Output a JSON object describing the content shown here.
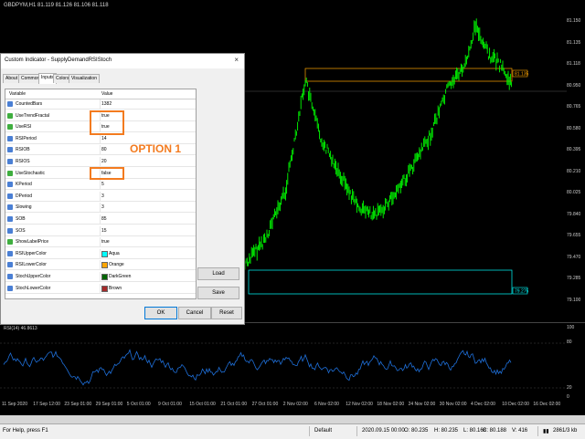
{
  "chart": {
    "header": "GBDPYM,H1 81.119 81.126 81.106 81.118",
    "price_labels": [
      "81.150",
      "81.135",
      "81.118",
      "80.950",
      "80.765",
      "80.580",
      "80.395",
      "80.210",
      "80.025",
      "79.840",
      "79.655",
      "79.470",
      "79.285",
      "79.100"
    ],
    "level_upper": "81.135",
    "level_lower": "79.275",
    "current": "81.118"
  },
  "rsi": {
    "header": "RSI(14) 46.8613",
    "levels": [
      "100",
      "80",
      "20",
      "0"
    ]
  },
  "time_axis": [
    "11 Sep 2020",
    "17 Sep 12:00",
    "23 Sep 01:00",
    "29 Sep 01:00",
    "5 Oct 01:00",
    "9 Oct 01:00",
    "15 Oct 01:00",
    "21 Oct 01:00",
    "27 Oct 01:00",
    "2 Nov 02:00",
    "6 Nov 02:00",
    "12 Nov 02:00",
    "18 Nov 02:00",
    "24 Nov 02:00",
    "30 Nov 02:00",
    "4 Dec 02:00",
    "10 Dec 02:00",
    "16 Dec 02:00"
  ],
  "status": {
    "help": "For Help, press F1",
    "profile": "Default",
    "datetime": "2020.09.15 00:00",
    "open": "O: 80.235",
    "high": "H: 80.235",
    "low": "L: 80.168",
    "close": "C: 80.188",
    "volume": "V: 416",
    "traffic": "2861/3 kb"
  },
  "dialog": {
    "title": "Custom Indicator - SupplyDemandRSIStoch",
    "close": "×",
    "tabs": [
      "About",
      "Common",
      "Inputs",
      "Colors",
      "Visualization"
    ],
    "active_tab": 2,
    "columns": [
      "Variable",
      "Value"
    ],
    "rows": [
      {
        "var": "CountedBars",
        "val": "1382",
        "icon": "123"
      },
      {
        "var": "UseTrendFractal",
        "val": "true",
        "icon": "bool"
      },
      {
        "var": "UseRSI",
        "val": "true",
        "icon": "bool"
      },
      {
        "var": "RSIPeriod",
        "val": "14",
        "icon": "123"
      },
      {
        "var": "RSIOB",
        "val": "80",
        "icon": "123"
      },
      {
        "var": "RSIOS",
        "val": "20",
        "icon": "123"
      },
      {
        "var": "UseStochastic",
        "val": "false",
        "icon": "bool"
      },
      {
        "var": "KPeriod",
        "val": "5",
        "icon": "123"
      },
      {
        "var": "DPeriod",
        "val": "3",
        "icon": "123"
      },
      {
        "var": "Slowing",
        "val": "3",
        "icon": "123"
      },
      {
        "var": "SOB",
        "val": "85",
        "icon": "123"
      },
      {
        "var": "SOS",
        "val": "15",
        "icon": "123"
      },
      {
        "var": "ShowLabelPrice",
        "val": "true",
        "icon": "bool"
      },
      {
        "var": "RSIUpperColor",
        "val": "Aqua",
        "icon": "color",
        "color": "#00ffff"
      },
      {
        "var": "RSILowerColor",
        "val": "Orange",
        "icon": "color",
        "color": "#ffa500"
      },
      {
        "var": "StochUpperColor",
        "val": "DarkGreen",
        "icon": "color",
        "color": "#006400"
      },
      {
        "var": "StochLowerColor",
        "val": "Brown",
        "icon": "color",
        "color": "#a52a2a"
      }
    ],
    "load": "Load",
    "save": "Save",
    "ok": "OK",
    "cancel": "Cancel",
    "reset": "Reset",
    "annotation": "OPTION 1"
  },
  "colors": {
    "candle": "#00ff00",
    "rsi_line": "#1e6fd9",
    "upper_zone": "#ffa500",
    "lower_zone": "#00ffff",
    "annotation": "#f37b1f"
  }
}
